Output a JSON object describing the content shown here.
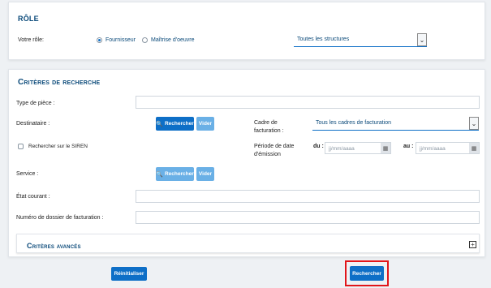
{
  "role": {
    "title": "Rôle",
    "your_role_label": "Votre rôle:",
    "options": [
      "Fournisseur",
      "Maîtrise d'oeuvre"
    ],
    "selected_option": "Fournisseur",
    "structure_select_value": "Toutes les structures"
  },
  "search": {
    "title": "Critères de recherche",
    "type_piece_label": "Type de pièce :",
    "destinataire_label": "Destinataire :",
    "search_button": "Rechercher",
    "clear_button": "Vider",
    "cadre_label_1": "Cadre de",
    "cadre_label_2": "facturation :",
    "cadre_select_value": "Tous les cadres de facturation",
    "siren_label": "Rechercher sur le SIREN",
    "periode_label_1": "Période de date",
    "periode_label_2": "d'émission",
    "du_label": "du :",
    "au_label": "au :",
    "date_placeholder": "jj/mm/aaaa",
    "service_label": "Service :",
    "etat_label": "État courant :",
    "dossier_label": "Numéro de dossier de facturation :",
    "advanced_title": "Critères avancés",
    "advanced_toggle": "+"
  },
  "actions": {
    "reset_button": "Réinitialiser",
    "submit_button": "Rechercher"
  },
  "colors": {
    "primary": "#0e6fc7",
    "primary_light": "#6ab0e6",
    "title": "#0b4a7a",
    "highlight": "#e1151a"
  }
}
